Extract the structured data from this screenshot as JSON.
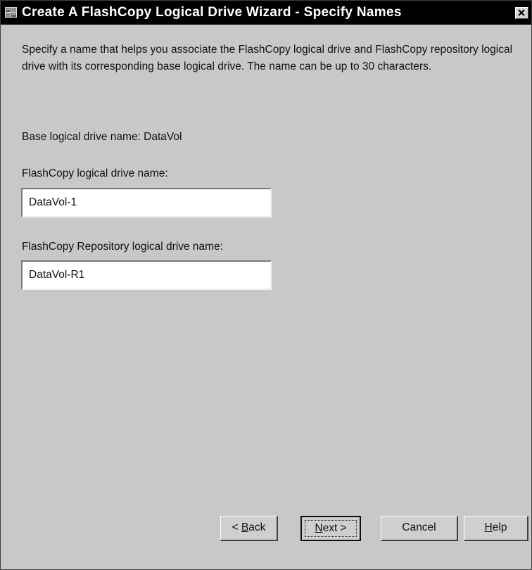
{
  "window": {
    "title": "Create A FlashCopy Logical Drive Wizard - Specify Names",
    "icon": "wizard-app-icon",
    "close_icon": "close-icon"
  },
  "main": {
    "description": "Specify a name that helps you associate the FlashCopy logical drive and FlashCopy repository logical drive with its corresponding base logical drive. The name can be up to 30 characters.",
    "base_label": "Base logical drive name: DataVol",
    "flashcopy_label": "FlashCopy logical drive name:",
    "flashcopy_value": "DataVol-1",
    "repository_label": "FlashCopy Repository logical drive name:",
    "repository_value": "DataVol-R1"
  },
  "buttons": {
    "back_prefix": "< ",
    "back_mnemonic": "B",
    "back_rest": "ack",
    "next_mnemonic": "N",
    "next_rest": "ext >",
    "cancel": "Cancel",
    "help_mnemonic": "H",
    "help_rest": "elp"
  },
  "colors": {
    "titlebar": "#000000",
    "dialog_background": "#c8c8c8",
    "field_background": "#ffffff"
  }
}
